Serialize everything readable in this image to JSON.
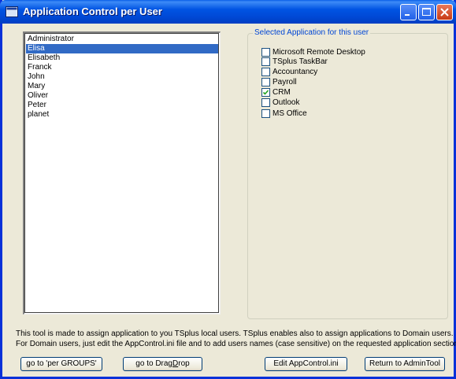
{
  "window": {
    "title": "Application Control per User"
  },
  "users": {
    "items": [
      "Administrator",
      "Elisa",
      "Elisabeth",
      "Franck",
      "John",
      "Mary",
      "Oliver",
      "Peter",
      "planet"
    ],
    "selected": "Elisa"
  },
  "applications": {
    "legend": "Selected Application for this user",
    "items": [
      {
        "label": "Microsoft Remote Desktop",
        "checked": false
      },
      {
        "label": "TSplus TaskBar",
        "checked": false
      },
      {
        "label": "Accountancy",
        "checked": false
      },
      {
        "label": "Payroll",
        "checked": false
      },
      {
        "label": "CRM",
        "checked": true
      },
      {
        "label": "Outlook",
        "checked": false
      },
      {
        "label": "MS Office",
        "checked": false
      }
    ]
  },
  "info": {
    "line1": "This tool is made to assign application to you TSplus local users. TSplus enables also to assign applications to Domain users.",
    "line2": "For Domain users, just edit the AppControl.ini file and to add users names (case sensitive) on the requested application section."
  },
  "buttons": {
    "groups": "go to 'per GROUPS'",
    "dragdrop_prefix": "go to Drag",
    "dragdrop_mnemonic": "D",
    "dragdrop_suffix": "rop",
    "edit_ini": "Edit AppControl.ini",
    "return": "Return to AdminTool"
  },
  "colors": {
    "titlebar": "#0054e3",
    "selection": "#316ac5",
    "legend": "#0046d5",
    "face": "#ece9d8"
  }
}
